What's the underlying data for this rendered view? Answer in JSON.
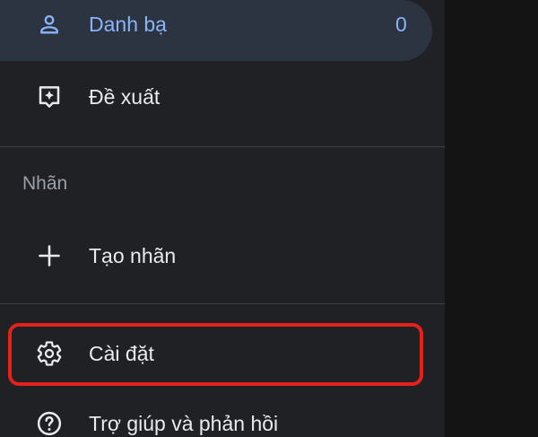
{
  "drawer": {
    "contacts": {
      "label": "Danh bạ",
      "count": "0",
      "icon": "person-icon"
    },
    "suggestions": {
      "label": "Đề xuất",
      "icon": "suggestion-icon"
    },
    "labels_section": {
      "title": "Nhãn"
    },
    "create_label": {
      "label": "Tạo nhãn",
      "icon": "plus-icon"
    },
    "settings": {
      "label": "Cài đặt",
      "icon": "gear-icon"
    },
    "help": {
      "label": "Trợ giúp và phản hồi",
      "icon": "help-icon"
    }
  },
  "colors": {
    "drawer_bg": "#202124",
    "active_bg": "#2c3442",
    "active_text": "#8ab4f8",
    "text": "#e8eaed",
    "highlight": "#e3211d"
  }
}
